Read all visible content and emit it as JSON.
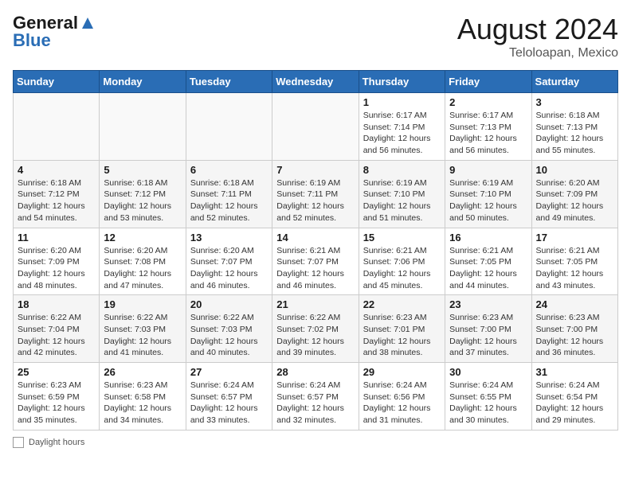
{
  "header": {
    "logo_general": "General",
    "logo_blue": "Blue",
    "month_year": "August 2024",
    "location": "Teloloapan, Mexico"
  },
  "footer": {
    "daylight_label": "Daylight hours"
  },
  "days_of_week": [
    "Sunday",
    "Monday",
    "Tuesday",
    "Wednesday",
    "Thursday",
    "Friday",
    "Saturday"
  ],
  "weeks": [
    [
      {
        "day": "",
        "info": ""
      },
      {
        "day": "",
        "info": ""
      },
      {
        "day": "",
        "info": ""
      },
      {
        "day": "",
        "info": ""
      },
      {
        "day": "1",
        "info": "Sunrise: 6:17 AM\nSunset: 7:14 PM\nDaylight: 12 hours\nand 56 minutes."
      },
      {
        "day": "2",
        "info": "Sunrise: 6:17 AM\nSunset: 7:13 PM\nDaylight: 12 hours\nand 56 minutes."
      },
      {
        "day": "3",
        "info": "Sunrise: 6:18 AM\nSunset: 7:13 PM\nDaylight: 12 hours\nand 55 minutes."
      }
    ],
    [
      {
        "day": "4",
        "info": "Sunrise: 6:18 AM\nSunset: 7:12 PM\nDaylight: 12 hours\nand 54 minutes."
      },
      {
        "day": "5",
        "info": "Sunrise: 6:18 AM\nSunset: 7:12 PM\nDaylight: 12 hours\nand 53 minutes."
      },
      {
        "day": "6",
        "info": "Sunrise: 6:18 AM\nSunset: 7:11 PM\nDaylight: 12 hours\nand 52 minutes."
      },
      {
        "day": "7",
        "info": "Sunrise: 6:19 AM\nSunset: 7:11 PM\nDaylight: 12 hours\nand 52 minutes."
      },
      {
        "day": "8",
        "info": "Sunrise: 6:19 AM\nSunset: 7:10 PM\nDaylight: 12 hours\nand 51 minutes."
      },
      {
        "day": "9",
        "info": "Sunrise: 6:19 AM\nSunset: 7:10 PM\nDaylight: 12 hours\nand 50 minutes."
      },
      {
        "day": "10",
        "info": "Sunrise: 6:20 AM\nSunset: 7:09 PM\nDaylight: 12 hours\nand 49 minutes."
      }
    ],
    [
      {
        "day": "11",
        "info": "Sunrise: 6:20 AM\nSunset: 7:09 PM\nDaylight: 12 hours\nand 48 minutes."
      },
      {
        "day": "12",
        "info": "Sunrise: 6:20 AM\nSunset: 7:08 PM\nDaylight: 12 hours\nand 47 minutes."
      },
      {
        "day": "13",
        "info": "Sunrise: 6:20 AM\nSunset: 7:07 PM\nDaylight: 12 hours\nand 46 minutes."
      },
      {
        "day": "14",
        "info": "Sunrise: 6:21 AM\nSunset: 7:07 PM\nDaylight: 12 hours\nand 46 minutes."
      },
      {
        "day": "15",
        "info": "Sunrise: 6:21 AM\nSunset: 7:06 PM\nDaylight: 12 hours\nand 45 minutes."
      },
      {
        "day": "16",
        "info": "Sunrise: 6:21 AM\nSunset: 7:05 PM\nDaylight: 12 hours\nand 44 minutes."
      },
      {
        "day": "17",
        "info": "Sunrise: 6:21 AM\nSunset: 7:05 PM\nDaylight: 12 hours\nand 43 minutes."
      }
    ],
    [
      {
        "day": "18",
        "info": "Sunrise: 6:22 AM\nSunset: 7:04 PM\nDaylight: 12 hours\nand 42 minutes."
      },
      {
        "day": "19",
        "info": "Sunrise: 6:22 AM\nSunset: 7:03 PM\nDaylight: 12 hours\nand 41 minutes."
      },
      {
        "day": "20",
        "info": "Sunrise: 6:22 AM\nSunset: 7:03 PM\nDaylight: 12 hours\nand 40 minutes."
      },
      {
        "day": "21",
        "info": "Sunrise: 6:22 AM\nSunset: 7:02 PM\nDaylight: 12 hours\nand 39 minutes."
      },
      {
        "day": "22",
        "info": "Sunrise: 6:23 AM\nSunset: 7:01 PM\nDaylight: 12 hours\nand 38 minutes."
      },
      {
        "day": "23",
        "info": "Sunrise: 6:23 AM\nSunset: 7:00 PM\nDaylight: 12 hours\nand 37 minutes."
      },
      {
        "day": "24",
        "info": "Sunrise: 6:23 AM\nSunset: 7:00 PM\nDaylight: 12 hours\nand 36 minutes."
      }
    ],
    [
      {
        "day": "25",
        "info": "Sunrise: 6:23 AM\nSunset: 6:59 PM\nDaylight: 12 hours\nand 35 minutes."
      },
      {
        "day": "26",
        "info": "Sunrise: 6:23 AM\nSunset: 6:58 PM\nDaylight: 12 hours\nand 34 minutes."
      },
      {
        "day": "27",
        "info": "Sunrise: 6:24 AM\nSunset: 6:57 PM\nDaylight: 12 hours\nand 33 minutes."
      },
      {
        "day": "28",
        "info": "Sunrise: 6:24 AM\nSunset: 6:57 PM\nDaylight: 12 hours\nand 32 minutes."
      },
      {
        "day": "29",
        "info": "Sunrise: 6:24 AM\nSunset: 6:56 PM\nDaylight: 12 hours\nand 31 minutes."
      },
      {
        "day": "30",
        "info": "Sunrise: 6:24 AM\nSunset: 6:55 PM\nDaylight: 12 hours\nand 30 minutes."
      },
      {
        "day": "31",
        "info": "Sunrise: 6:24 AM\nSunset: 6:54 PM\nDaylight: 12 hours\nand 29 minutes."
      }
    ]
  ]
}
